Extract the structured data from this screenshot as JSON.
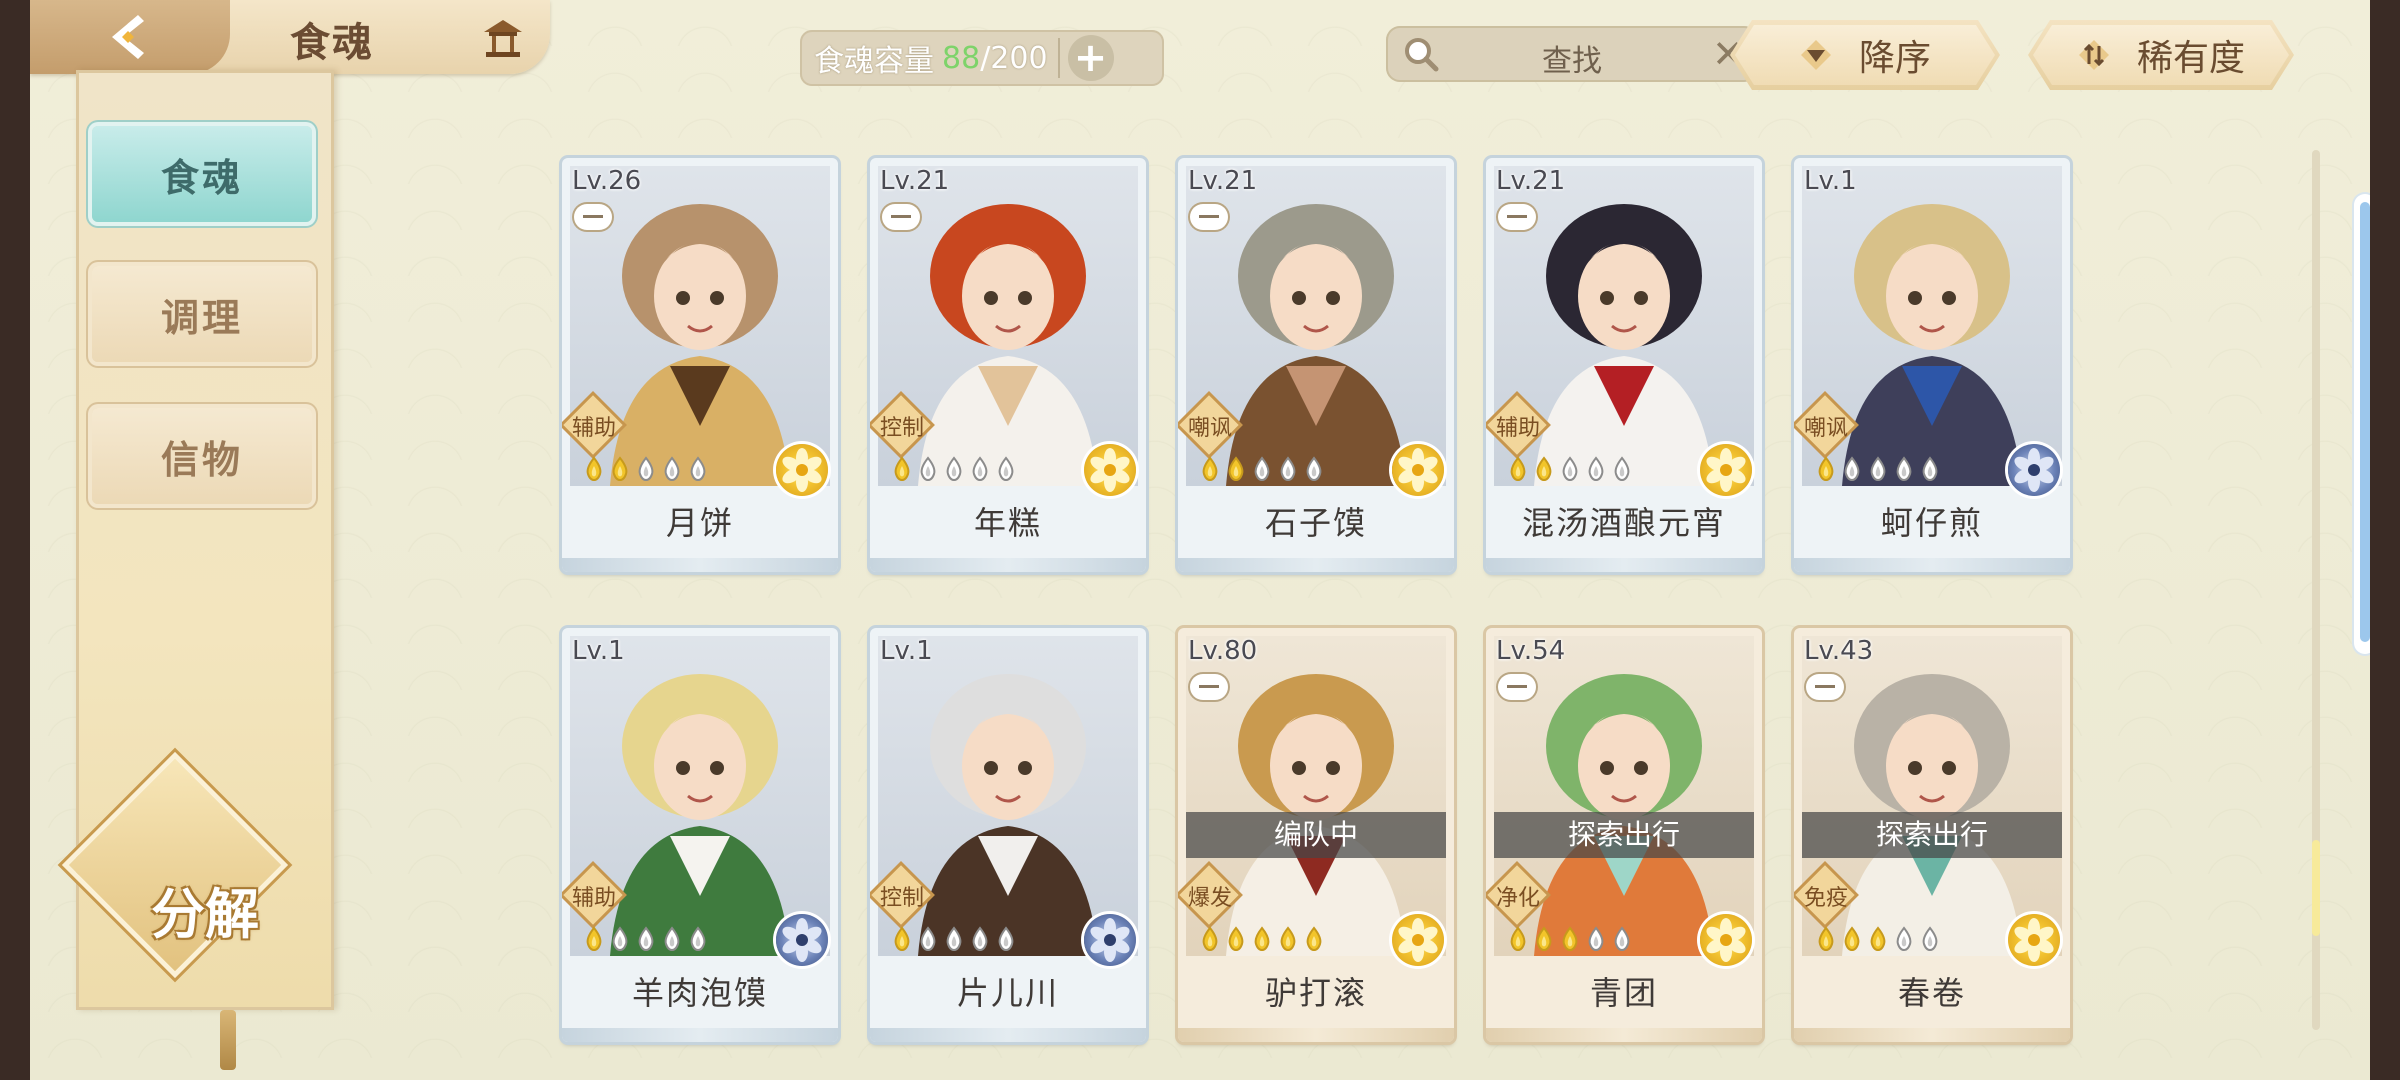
{
  "header": {
    "title": "食魂",
    "capacity_label": "食魂容量",
    "capacity_current": "88",
    "capacity_separator": "/",
    "capacity_max": "200",
    "search_text": "查找",
    "sort_order_label": "降序",
    "sort_field_label": "稀有度"
  },
  "sidebar": {
    "items": [
      {
        "label": "食魂"
      },
      {
        "label": "调理"
      },
      {
        "label": "信物"
      }
    ],
    "decompose_label": "分解"
  },
  "cards": [
    {
      "level": "Lv.26",
      "role": "辅助",
      "name": "月饼",
      "stars": 2,
      "rarity": "gold",
      "status": "",
      "palette": [
        "#b7926c",
        "#d9b065",
        "#5a3a1e"
      ]
    },
    {
      "level": "Lv.21",
      "role": "控制",
      "name": "年糕",
      "stars": 1,
      "rarity": "gold",
      "status": "",
      "palette": [
        "#c8471f",
        "#f4f1ec",
        "#e2c39a"
      ]
    },
    {
      "level": "Lv.21",
      "role": "嘲讽",
      "name": "石子馍",
      "stars": 2,
      "rarity": "gold",
      "status": "",
      "palette": [
        "#9c9a8c",
        "#7a5230",
        "#c59473"
      ]
    },
    {
      "level": "Lv.21",
      "role": "辅助",
      "name": "混汤酒酿元宵",
      "stars": 2,
      "rarity": "gold",
      "status": "",
      "palette": [
        "#2b2733",
        "#f4f2ef",
        "#b41f24"
      ]
    },
    {
      "level": "Lv.1",
      "role": "嘲讽",
      "name": "蚵仔煎",
      "stars": 1,
      "rarity": "blue",
      "status": "",
      "palette": [
        "#d8c189",
        "#3e3f5a",
        "#2d56a8"
      ]
    },
    {
      "level": "Lv.1",
      "role": "辅助",
      "name": "羊肉泡馍",
      "stars": 1,
      "rarity": "blue",
      "status": "",
      "palette": [
        "#e6d58e",
        "#3f7b3e",
        "#f5f3ef"
      ]
    },
    {
      "level": "Lv.1",
      "role": "控制",
      "name": "片儿川",
      "stars": 1,
      "rarity": "blue",
      "status": "",
      "palette": [
        "#dedede",
        "#4b3426",
        "#f1efed"
      ]
    },
    {
      "level": "Lv.80",
      "role": "爆发",
      "name": "驴打滚",
      "stars": 5,
      "rarity": "gold",
      "status": "编队中",
      "palette": [
        "#c99a4f",
        "#f5efe5",
        "#8e2a21"
      ]
    },
    {
      "level": "Lv.54",
      "role": "净化",
      "name": "青团",
      "stars": 3,
      "rarity": "gold",
      "status": "探索出行",
      "palette": [
        "#7fb46a",
        "#e07a3a",
        "#9ed6c8"
      ]
    },
    {
      "level": "Lv.43",
      "role": "免疫",
      "name": "春卷",
      "stars": 3,
      "rarity": "gold",
      "status": "探索出行",
      "palette": [
        "#b9b2a6",
        "#f3efe6",
        "#6bb4a4"
      ]
    }
  ],
  "colors": {
    "accent_teal": "#8fd6cf",
    "gold": "#f2c230",
    "capacity_green": "#7ed36a"
  }
}
